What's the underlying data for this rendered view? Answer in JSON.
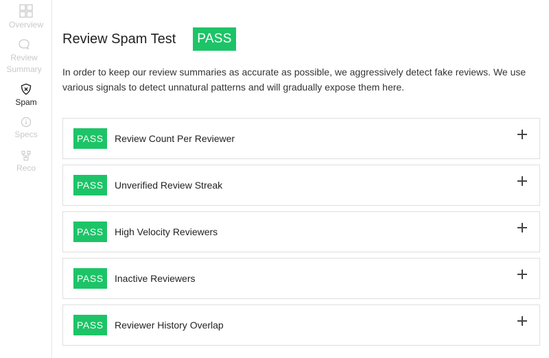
{
  "sidebar": {
    "items": [
      {
        "label": "Overview",
        "icon": "grid-icon",
        "active": false
      },
      {
        "label": "Review Summary",
        "icon": "chat-bubble-icon",
        "active": false
      },
      {
        "label": "Spam",
        "icon": "shield-x-icon",
        "active": true
      },
      {
        "label": "Specs",
        "icon": "info-circle-icon",
        "active": false
      },
      {
        "label": "Reco",
        "icon": "reco-icon",
        "active": false
      }
    ],
    "active_color": "#222222",
    "inactive_color": "#c9c9c9"
  },
  "main": {
    "title": "Review Spam Test",
    "result": "PASS",
    "intro": "In order to keep our review summaries as accurate as possible, we aggressively detect fake reviews. We use various signals to detect unnatural patterns and will gradually expose them here.",
    "tests": [
      {
        "status": "PASS",
        "label": "Review Count Per Reviewer"
      },
      {
        "status": "PASS",
        "label": "Unverified Review Streak"
      },
      {
        "status": "PASS",
        "label": "High Velocity Reviewers"
      },
      {
        "status": "PASS",
        "label": "Inactive Reviewers"
      },
      {
        "status": "PASS",
        "label": "Reviewer History Overlap"
      }
    ]
  },
  "colors": {
    "pass_green": "#1dc467",
    "border": "#dedede"
  }
}
